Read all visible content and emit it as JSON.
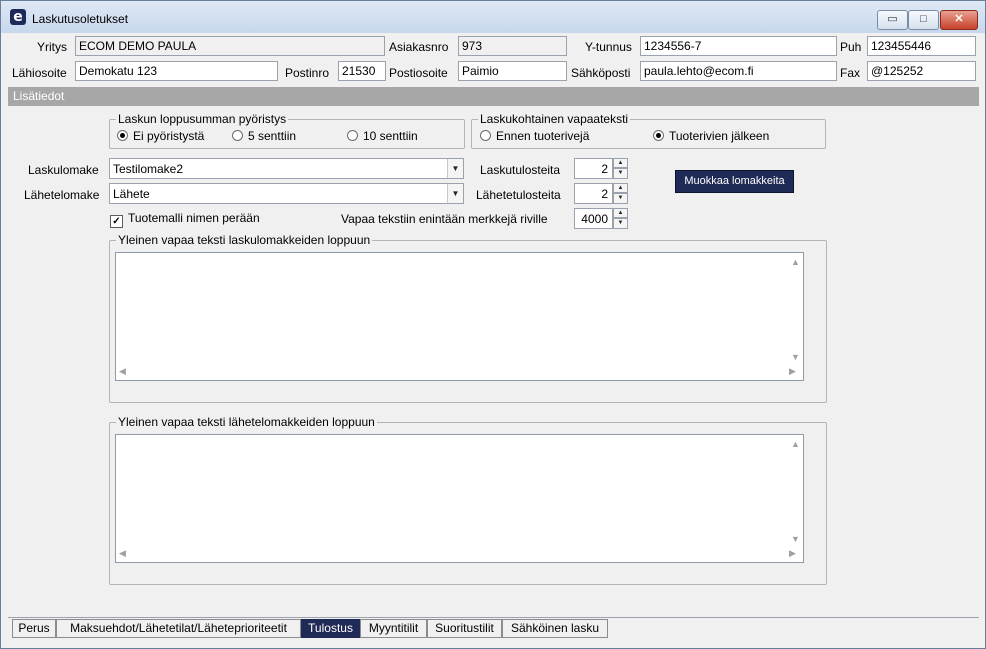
{
  "window": {
    "title": "Laskutusoletukset",
    "app_icon_glyph": "e",
    "min_glyph": "▭",
    "max_glyph": "□",
    "close_glyph": "✕"
  },
  "company": {
    "yritys_label": "Yritys",
    "yritys_value": "ECOM DEMO PAULA",
    "asiakasnro_label": "Asiakasnro",
    "asiakasnro_value": "973",
    "ytunnus_label": "Y-tunnus",
    "ytunnus_value": "1234556-7",
    "puh_label": "Puh",
    "puh_value": "123455446",
    "lahiosoite_label": "Lähiosoite",
    "lahiosoite_value": "Demokatu 123",
    "postinro_label": "Postinro",
    "postinro_value": "21530",
    "postiosoite_label": "Postiosoite",
    "postiosoite_value": "Paimio",
    "sahkoposti_label": "Sähköposti",
    "sahkoposti_value": "paula.lehto@ecom.fi",
    "fax_label": "Fax",
    "fax_value": "@125252"
  },
  "section": {
    "title": "Lisätiedot"
  },
  "rounding": {
    "title": "Laskun loppusumman pyöristys",
    "options": [
      "Ei pyöristystä",
      "5 senttiin",
      "10 senttiin"
    ],
    "selected": "Ei pyöristystä"
  },
  "freetext": {
    "title": "Laskukohtainen vapaateksti",
    "options": [
      "Ennen tuoterivejä",
      "Tuoterivien jälkeen"
    ],
    "selected": "Tuoterivien jälkeen"
  },
  "forms": {
    "laskulomake_label": "Laskulomake",
    "laskulomake_value": "Testilomake2",
    "lahetelomake_label": "Lähetelomake",
    "lahetelomake_value": "Lähete",
    "laskutulosteita_label": "Laskutulosteita",
    "laskutulosteita_value": "2",
    "lahetetulosteita_label": "Lähetetulosteita",
    "lahetetulosteita_value": "2",
    "edit_button": "Muokkaa lomakkeita",
    "tuotemalli_label": "Tuotemalli nimen perään",
    "tuotemalli_checked": true,
    "maxchars_label": "Vapaa tekstiin enintään merkkejä riville",
    "maxchars_value": "4000"
  },
  "invoice_text": {
    "title": "Yleinen vapaa teksti laskulomakkeiden loppuun",
    "value": ""
  },
  "delivery_text": {
    "title": "Yleinen vapaa teksti lähetelomakkeiden loppuun",
    "value": ""
  },
  "tabs": [
    {
      "label": "Perus",
      "active": false
    },
    {
      "label": "Maksuehdot/Lähetetilat/Läheteprioriteetit",
      "active": false
    },
    {
      "label": "Tulostus",
      "active": true
    },
    {
      "label": "Myyntitilit",
      "active": false
    },
    {
      "label": "Suoritustilit",
      "active": false
    },
    {
      "label": "Sähköinen lasku",
      "active": false
    }
  ],
  "colors": {
    "accent": "#1f2a56",
    "section_bar": "#a7a7a7",
    "close_button": "#c6412a"
  }
}
